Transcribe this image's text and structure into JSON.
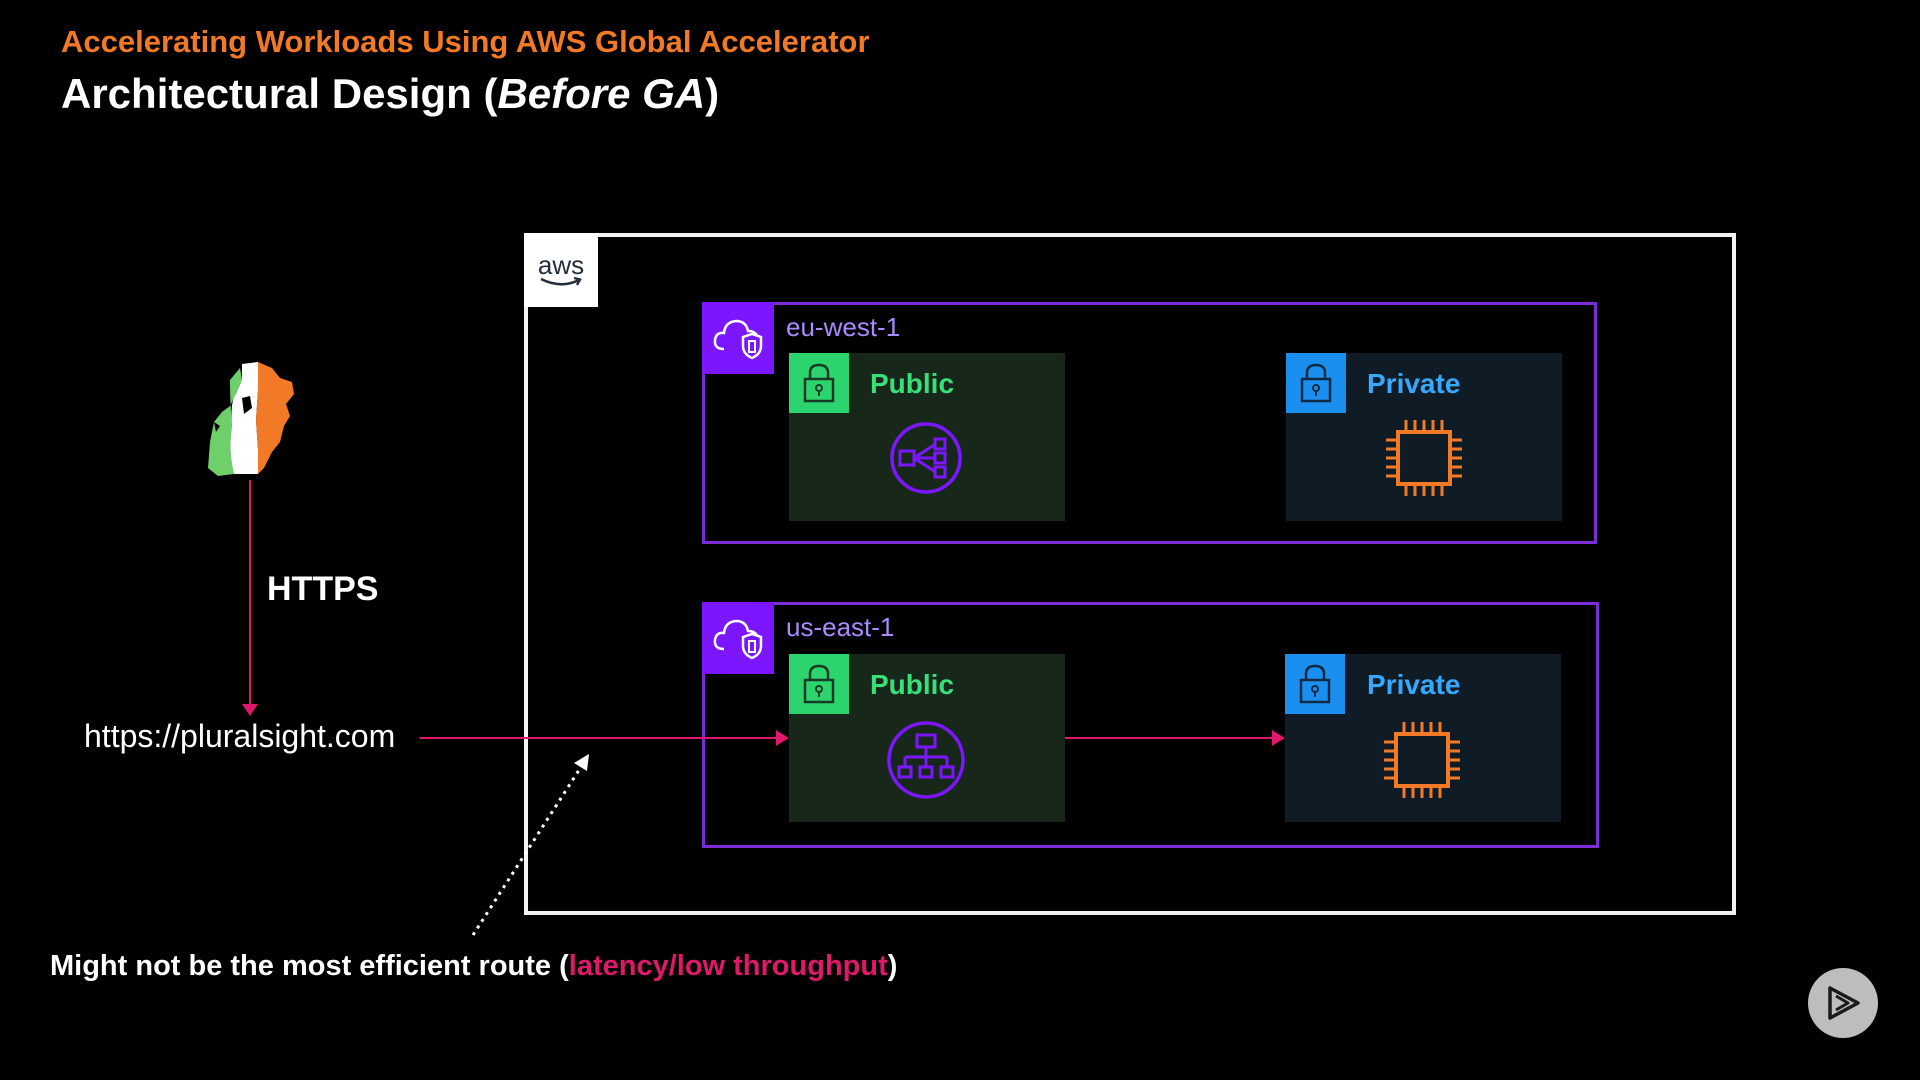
{
  "header": {
    "subtitle": "Accelerating Workloads Using AWS Global Accelerator",
    "title_main": "Architectural Design ",
    "title_open": "(",
    "title_emph": "Before GA",
    "title_close": ")"
  },
  "aws": {
    "logo_text": "aws"
  },
  "regions": [
    {
      "name": "eu-west-1",
      "public_label": "Public",
      "public_icon": "network-load-balancer-icon",
      "private_label": "Private",
      "private_icon": "ec2-instance-icon"
    },
    {
      "name": "us-east-1",
      "public_label": "Public",
      "public_icon": "application-load-balancer-icon",
      "private_label": "Private",
      "private_icon": "ec2-instance-icon"
    }
  ],
  "client": {
    "icon": "ireland-map-icon",
    "protocol_label": "HTTPS",
    "url": "https://pluralsight.com"
  },
  "note": {
    "prefix": "Might not be the most efficient route (",
    "highlight": "latency/low throughput",
    "suffix": ")"
  },
  "colors": {
    "accent_orange": "#f27a26",
    "region_purple": "#7b16ff",
    "public_green": "#2bd46c",
    "private_blue": "#1b8ff0",
    "arrow_pink": "#e0186c",
    "chip_orange": "#f27a26"
  },
  "player": {
    "icon": "play-icon"
  }
}
